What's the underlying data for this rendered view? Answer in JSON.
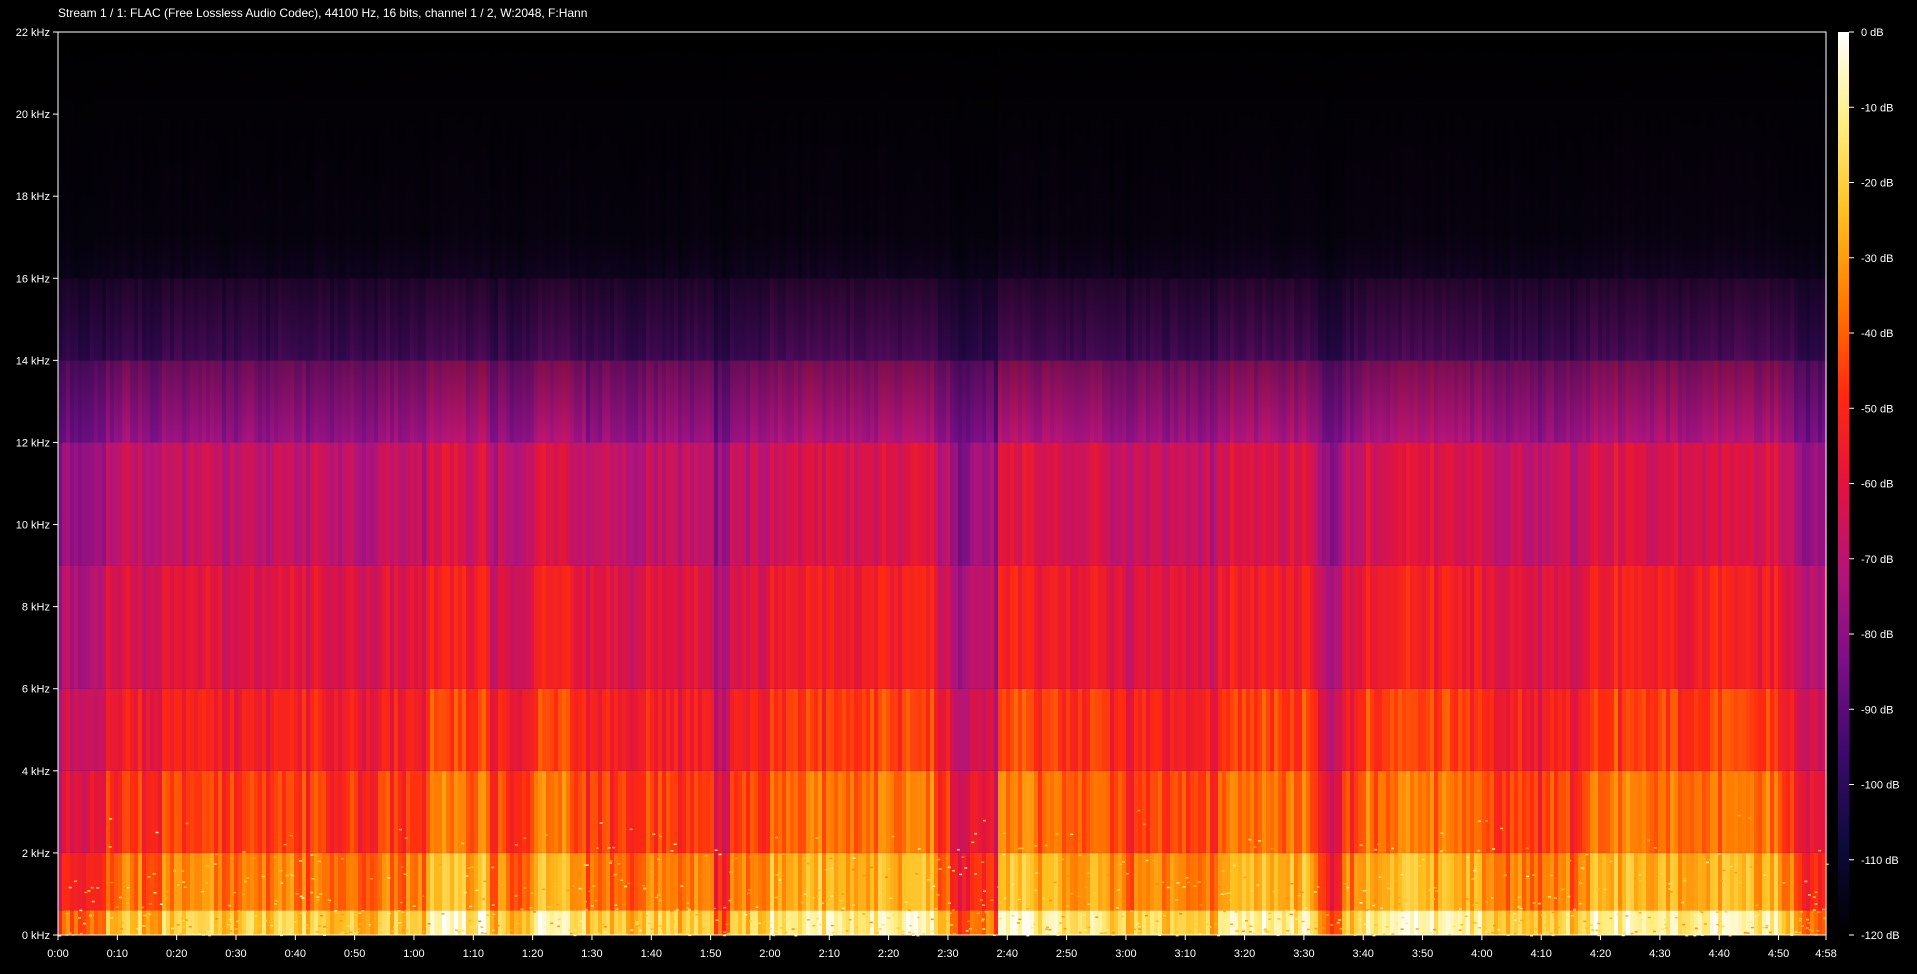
{
  "header": {
    "text": "Stream 1 / 1: FLAC (Free Lossless Audio Codec), 44100 Hz, 16 bits, channel 1 / 2, W:2048, F:Hann"
  },
  "chart_data": {
    "type": "heatmap",
    "title": "Stream 1 / 1: FLAC (Free Lossless Audio Codec), 44100 Hz, 16 bits, channel 1 / 2, W:2048, F:Hann",
    "x_ticks": [
      "0:00",
      "0:10",
      "0:20",
      "0:30",
      "0:40",
      "0:50",
      "1:00",
      "1:10",
      "1:20",
      "1:30",
      "1:40",
      "1:50",
      "2:00",
      "2:10",
      "2:20",
      "2:30",
      "2:40",
      "2:50",
      "3:00",
      "3:10",
      "3:20",
      "3:30",
      "3:40",
      "3:50",
      "4:00",
      "4:10",
      "4:20",
      "4:30",
      "4:40",
      "4:50",
      "4:58"
    ],
    "x_tick_seconds": [
      0,
      10,
      20,
      30,
      40,
      50,
      60,
      70,
      80,
      90,
      100,
      110,
      120,
      130,
      140,
      150,
      160,
      170,
      180,
      190,
      200,
      210,
      220,
      230,
      240,
      250,
      260,
      270,
      280,
      290,
      298
    ],
    "xlim": [
      0,
      298
    ],
    "y_ticks": [
      "0 kHz",
      "2 kHz",
      "4 kHz",
      "6 kHz",
      "8 kHz",
      "10 kHz",
      "12 kHz",
      "14 kHz",
      "16 kHz",
      "18 kHz",
      "20 kHz",
      "22 kHz"
    ],
    "y_tick_khz": [
      0,
      2,
      4,
      6,
      8,
      10,
      12,
      14,
      16,
      18,
      20,
      22
    ],
    "ylim": [
      0,
      22
    ],
    "colorbar": {
      "ticks": [
        "0 dB",
        "-10 dB",
        "-20 dB",
        "-30 dB",
        "-40 dB",
        "-50 dB",
        "-60 dB",
        "-70 dB",
        "-80 dB",
        "-90 dB",
        "-100 dB",
        "-110 dB",
        "-120 dB"
      ],
      "tick_db": [
        0,
        -10,
        -20,
        -30,
        -40,
        -50,
        -60,
        -70,
        -80,
        -90,
        -100,
        -110,
        -120
      ],
      "range": [
        -120,
        0
      ],
      "colors": [
        "#000000",
        "#0d0a3a",
        "#3b0a6b",
        "#7a0f86",
        "#b3147a",
        "#e0143f",
        "#ff2a10",
        "#ff7a00",
        "#ffc020",
        "#ffee80",
        "#ffffff"
      ]
    }
  }
}
